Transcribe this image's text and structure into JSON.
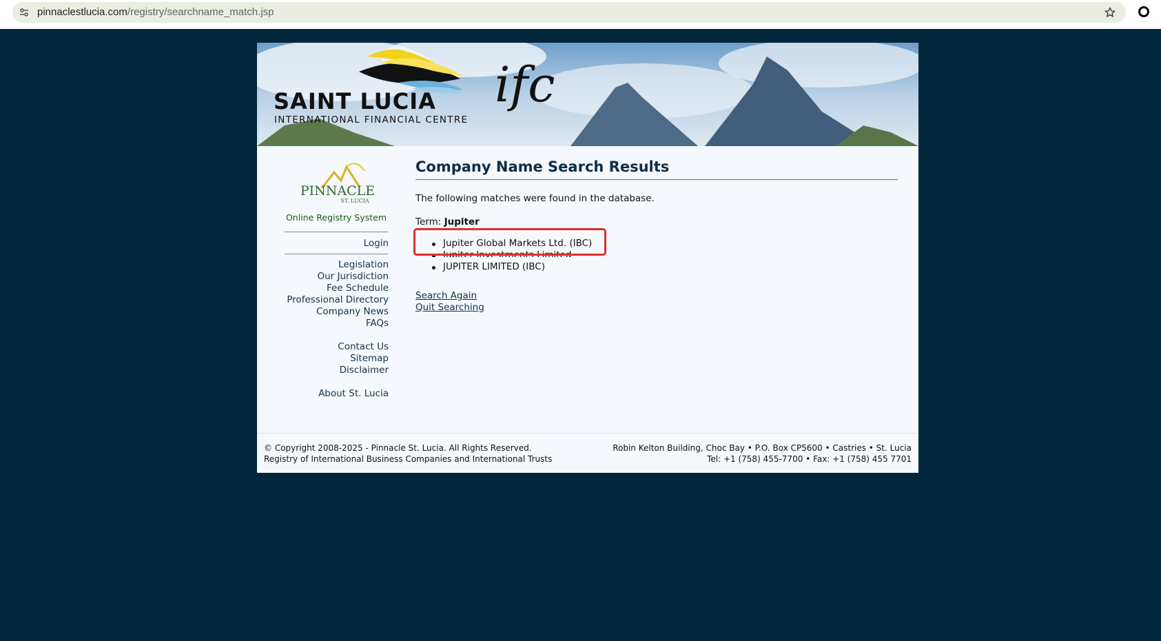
{
  "browser": {
    "url_host": "pinnaclestlucia.com",
    "url_path": "/registry/searchname_match.jsp"
  },
  "banner": {
    "title": "SAINT LUCIA",
    "subtitle": "INTERNATIONAL FINANCIAL CENTRE",
    "ifc": "ifc"
  },
  "sidebar": {
    "logo_text": "PINNACLE",
    "logo_subtext": "ST. LUCIA",
    "registry_label": "Online Registry System",
    "login": "Login",
    "links": [
      "Legislation",
      "Our Jurisdiction",
      "Fee Schedule",
      "Professional Directory",
      "Company News",
      "FAQs"
    ],
    "links2": [
      "Contact Us",
      "Sitemap",
      "Disclaimer"
    ],
    "links3": [
      "About St. Lucia"
    ]
  },
  "content": {
    "title": "Company Name Search Results",
    "intro": "The following matches were found in the database.",
    "term_label": "Term:",
    "term_value": "Jupiter",
    "results": [
      "Jupiter Global Markets Ltd. (IBC)",
      "Jupiter Investments Limited",
      "JUPITER LIMITED (IBC)"
    ],
    "search_again": "Search Again",
    "quit_searching": "Quit Searching"
  },
  "footer": {
    "copyright": "© Copyright 2008-2025 - Pinnacle St. Lucia. All Rights Reserved.",
    "registry": "Registry of International Business Companies and International Trusts",
    "address": "Robin Kelton Building, Choc Bay • P.O. Box CP5600 • Castries • St. Lucia",
    "phone": "Tel: +1 (758) 455-7700 • Fax: +1 (758) 455 7701"
  },
  "colors": {
    "background": "#02263c",
    "highlight": "#d9322a",
    "link": "#12324a",
    "registry_green": "#1c5a1c"
  },
  "icons": [
    "site-info-icon",
    "bookmark-star-icon",
    "profile-icon"
  ]
}
